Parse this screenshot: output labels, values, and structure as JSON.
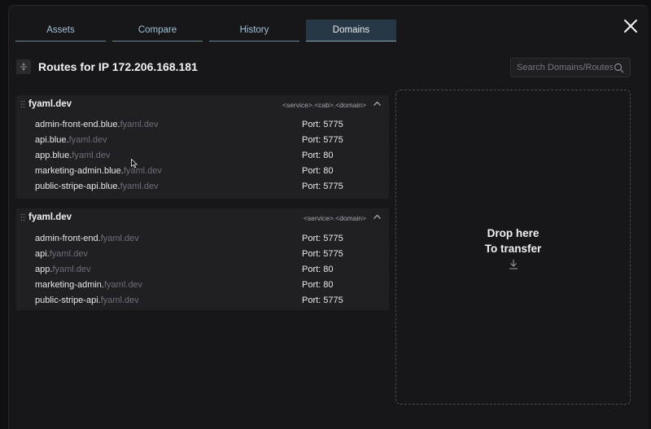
{
  "tabs": [
    "Assets",
    "Compare",
    "History",
    "Domains"
  ],
  "active_tab": "Domains",
  "header": {
    "title": "Routes for IP 172.206.168.181"
  },
  "search": {
    "placeholder": "Search Domains/Routes"
  },
  "groups": [
    {
      "name": "fyaml.dev",
      "pattern": "<service>.<cab>.<domain>",
      "routes": [
        {
          "sub": "admin-front-end.blue.",
          "domain": "fyaml.dev",
          "port": "Port: 5775"
        },
        {
          "sub": "api.blue.",
          "domain": "fyaml.dev",
          "port": "Port: 5775"
        },
        {
          "sub": "app.blue.",
          "domain": "fyaml.dev",
          "port": "Port: 80"
        },
        {
          "sub": "marketing-admin.blue.",
          "domain": "fyaml.dev",
          "port": "Port: 80"
        },
        {
          "sub": "public-stripe-api.blue.",
          "domain": "fyaml.dev",
          "port": "Port: 5775"
        }
      ]
    },
    {
      "name": "fyaml.dev",
      "pattern": "<service>.<domain>",
      "routes": [
        {
          "sub": "admin-front-end.",
          "domain": "fyaml.dev",
          "port": "Port: 5775"
        },
        {
          "sub": "api.",
          "domain": "fyaml.dev",
          "port": "Port: 5775"
        },
        {
          "sub": "app.",
          "domain": "fyaml.dev",
          "port": "Port: 80"
        },
        {
          "sub": "marketing-admin.",
          "domain": "fyaml.dev",
          "port": "Port: 80"
        },
        {
          "sub": "public-stripe-api.",
          "domain": "fyaml.dev",
          "port": "Port: 5775"
        }
      ]
    }
  ],
  "dropzone": {
    "line1": "Drop here",
    "line2": "To transfer"
  },
  "icons": [
    "close-icon",
    "collapse-icon",
    "search-icon",
    "drag-handle-icon",
    "chevron-up-icon",
    "download-arrow-icon",
    "mouse-cursor-icon"
  ],
  "colors": {
    "accent": "#9fc2d8",
    "active_tab_bg": "#273745",
    "muted_domain": "#6e6e74"
  }
}
